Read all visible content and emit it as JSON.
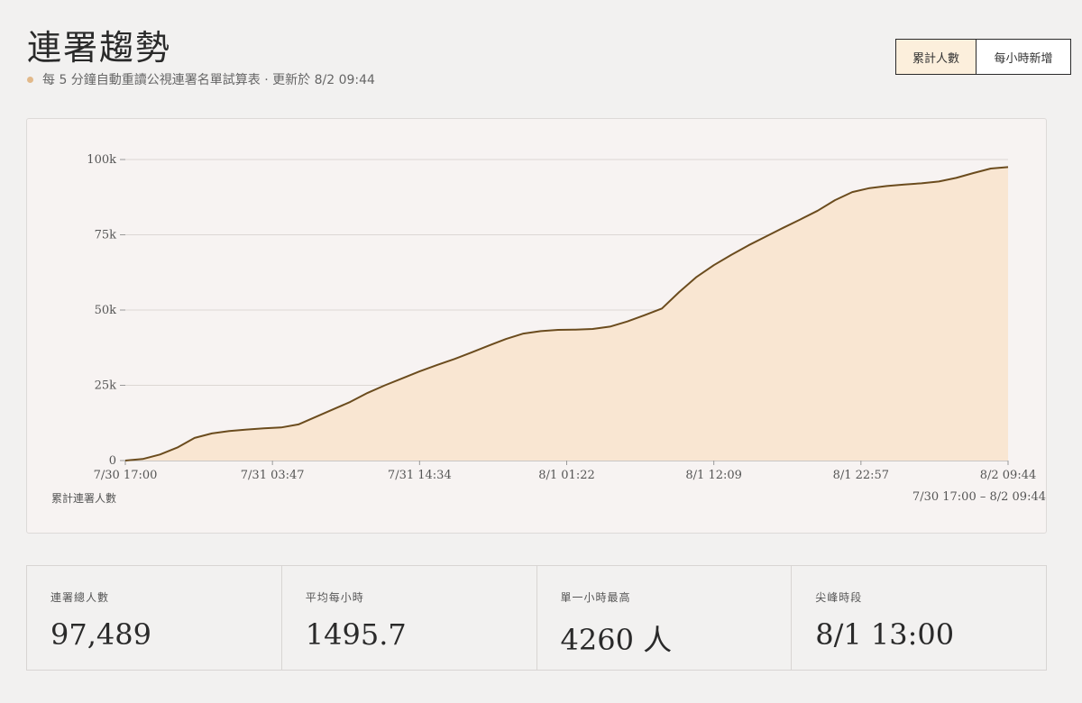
{
  "header": {
    "title": "連署趨勢",
    "subtitle": "每 5 分鐘自動重讀公視連署名單試算表 · 更新於 8/2 09:44"
  },
  "toggle": {
    "cumulative_label": "累計人數",
    "hourly_label": "每小時新增"
  },
  "chart": {
    "caption": "累計連署人數",
    "range_label": "7/30 17:00 – 8/2 09:44"
  },
  "chart_data": {
    "type": "area",
    "title": "",
    "xlabel": "",
    "ylabel": "",
    "ylim": [
      0,
      100000
    ],
    "yticks": [
      0,
      25000,
      50000,
      75000,
      100000
    ],
    "ytick_labels": [
      "0",
      "25k",
      "50k",
      "75k",
      "100k"
    ],
    "xtick_labels": [
      "7/30 17:00",
      "7/31 03:47",
      "7/31 14:34",
      "8/1 01:22",
      "8/1 12:09",
      "8/1 22:57",
      "8/2 09:44"
    ],
    "x_hours_range": [
      0,
      64.73
    ],
    "grid": "horizontal",
    "line_color": "#6b4c1e",
    "fill_color": "#f9e6d2",
    "series": [
      {
        "x_hours": [
          0,
          1,
          2,
          3,
          4,
          5,
          6,
          7,
          8,
          9,
          10,
          11,
          12,
          13,
          14,
          15,
          16,
          17,
          18,
          19,
          20,
          21,
          22,
          23,
          24,
          25,
          26,
          27,
          28,
          29,
          30,
          31,
          32,
          33,
          34,
          35,
          36,
          37,
          38,
          39,
          40,
          41,
          42,
          43,
          44,
          45,
          46,
          47,
          48,
          49,
          50,
          51,
          52,
          53,
          54,
          55,
          56,
          57,
          58,
          59,
          60,
          61,
          62,
          63,
          64,
          64.73
        ],
        "values": [
          0,
          500,
          2000,
          4300,
          7500,
          9000,
          9800,
          10300,
          10700,
          11000,
          12000,
          14500,
          17000,
          19500,
          22500,
          25000,
          27300,
          29600,
          31700,
          33700,
          35900,
          38200,
          40400,
          42200,
          43000,
          43400,
          43500,
          43700,
          44500,
          46200,
          48300,
          50500,
          56000,
          61000,
          64900,
          68300,
          71500,
          74400,
          77300,
          80100,
          83000,
          86500,
          89200,
          90500,
          91200,
          91700,
          92100,
          92700,
          93900,
          95500,
          97000,
          97489
        ]
      }
    ]
  },
  "stats": [
    {
      "label": "連署總人數",
      "value": "97,489"
    },
    {
      "label": "平均每小時",
      "value": "1495.7"
    },
    {
      "label": "單一小時最高",
      "value": "4260 人"
    },
    {
      "label": "尖峰時段",
      "value": "8/1 13:00"
    }
  ]
}
